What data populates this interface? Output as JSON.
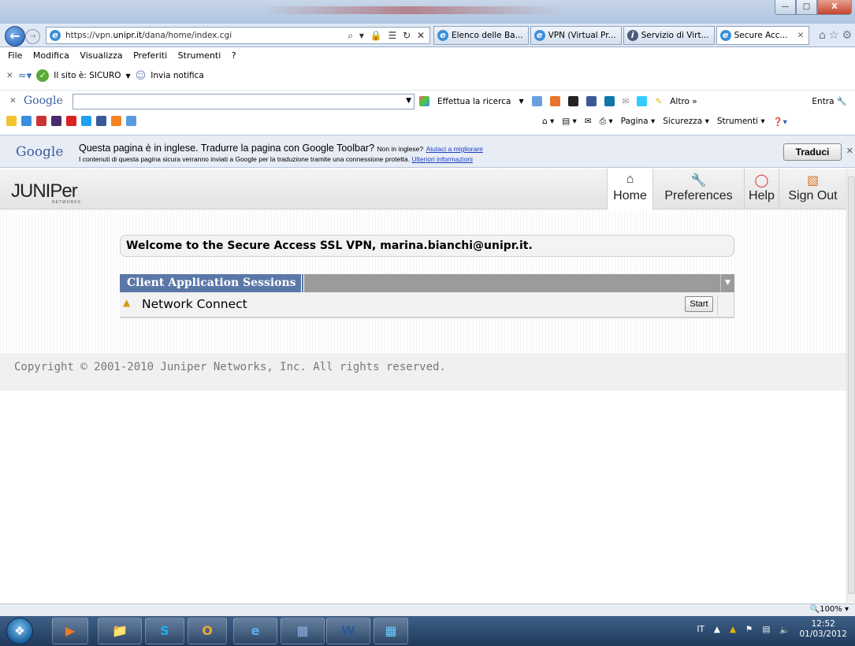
{
  "browser": {
    "url_prefix": "https://vpn.",
    "url_host": "unipr.it",
    "url_path": "/dana/home/index.cgi",
    "address_controls": "⌕ ▾ 🔒 ☰ ↻ ✕",
    "tabs": [
      {
        "label": "Elenco delle Ba...",
        "active": false
      },
      {
        "label": "VPN (Virtual Pr...",
        "active": false
      },
      {
        "label": "Servizio di Virt...",
        "active": false
      },
      {
        "label": "Secure Acc...",
        "active": true
      }
    ]
  },
  "menu": [
    "File",
    "Modifica",
    "Visualizza",
    "Preferiti",
    "Strumenti",
    "?"
  ],
  "security_bar": {
    "site_status": "Il sito è: SICURO",
    "notify": "Invia notifica"
  },
  "google_toolbar": {
    "logo": "Google",
    "search": "Effettua la ricerca",
    "more": "Altro",
    "signin": "Entra"
  },
  "command_bar": {
    "page": "Pagina",
    "security": "Sicurezza",
    "tools": "Strumenti"
  },
  "translate_bar": {
    "logo": "Google",
    "message": "Questa pagina è in inglese. Tradurre la pagina con Google Toolbar?",
    "not_english": "Non in inglese?",
    "help_improve": "Aiutaci a migliorare",
    "privacy": "I contenuti di questa pagina sicura verranno inviati a Google per la traduzione tramite una connessione protetta.",
    "more_info": "Ulteriori informazioni",
    "translate_button": "Traduci"
  },
  "page": {
    "logo": "JUNIPer",
    "logo_sub": "NETWORKS",
    "nav": {
      "home": "Home",
      "preferences": "Preferences",
      "help": "Help",
      "sign_out": "Sign Out"
    },
    "welcome": "Welcome to the Secure Access SSL VPN, marina.bianchi@unipr.it.",
    "sessions_title": "Client Application Sessions",
    "sessions": [
      {
        "name": "Network Connect",
        "action": "Start"
      }
    ],
    "copyright": "Copyright © 2001-2010 Juniper Networks, Inc. All rights reserved."
  },
  "status": {
    "zoom": "100%"
  },
  "taskbar": {
    "language": "IT",
    "time": "12:52",
    "date": "01/03/2012"
  },
  "colors": {
    "panel_title_bg": "#5b77a8",
    "panel_head_bg": "#9b9b9b",
    "translate_bar_bg": "#e7ecf5"
  }
}
